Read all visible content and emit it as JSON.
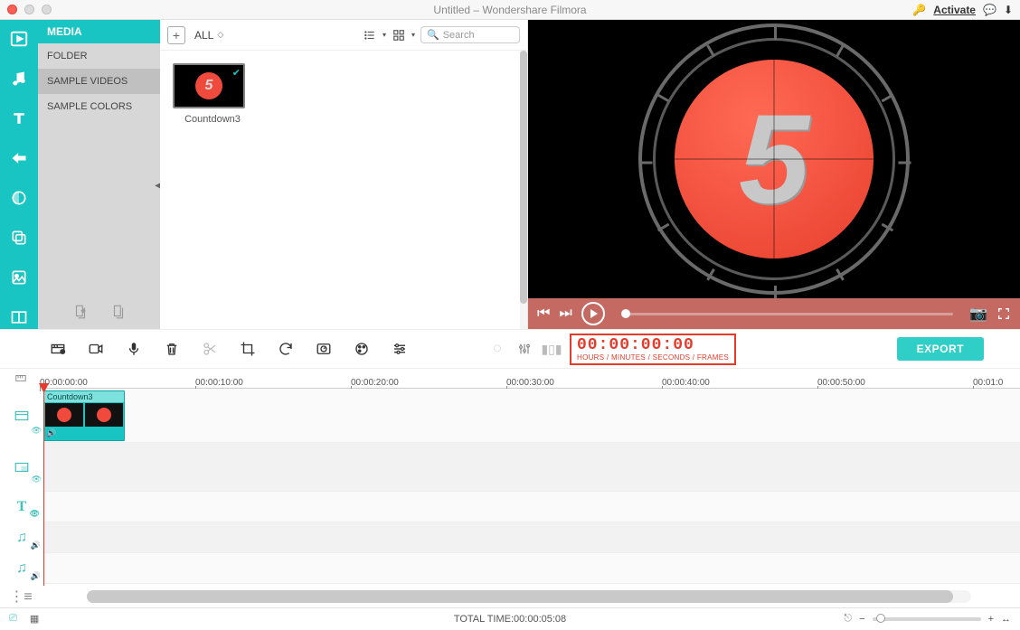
{
  "titlebar": {
    "title": "Untitled – Wondershare Filmora",
    "activate": "Activate"
  },
  "sidebar": {
    "header": "MEDIA",
    "categories": [
      "FOLDER",
      "SAMPLE VIDEOS",
      "SAMPLE COLORS"
    ],
    "selected_index": 1
  },
  "browser": {
    "filter_label": "ALL",
    "search_placeholder": "Search",
    "items": [
      {
        "caption": "Countdown3",
        "figure": "5",
        "selected": true
      }
    ]
  },
  "preview": {
    "figure": "5"
  },
  "toolbar": {
    "timecode": "00:00:00:00",
    "timecode_label": "HOURS / MINUTES / SECONDS / FRAMES",
    "export_label": "EXPORT"
  },
  "timeline": {
    "marks": [
      "00:00:00:00",
      "00:00:10:00",
      "00:00:20:00",
      "00:00:30:00",
      "00:00:40:00",
      "00:00:50:00",
      "00:01:0"
    ],
    "clip": {
      "label": "Countdown3"
    },
    "total_time_label": "TOTAL TIME:",
    "total_time_value": "00:00:05:08"
  }
}
